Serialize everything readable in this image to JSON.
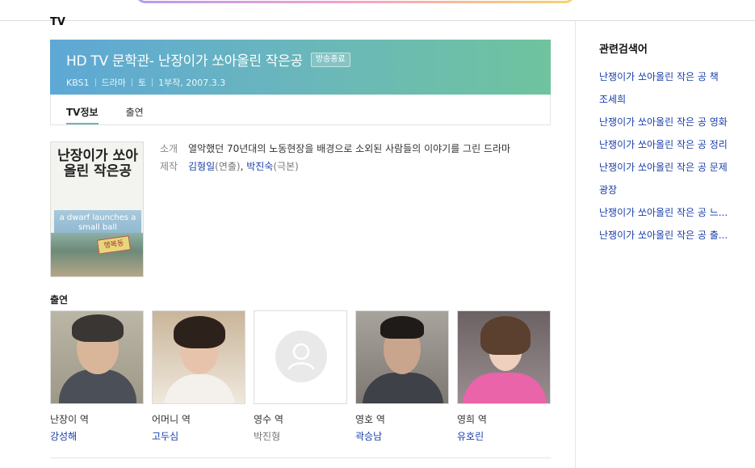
{
  "header": {
    "section_label": "TV"
  },
  "banner": {
    "title": "HD TV 문학관- 난장이가 쏘아올린 작은공",
    "badge": "방송종료",
    "meta": [
      "KBS1",
      "드라마",
      "토",
      "1부작, 2007.3.3"
    ]
  },
  "tabs": [
    {
      "label": "TV정보",
      "active": true
    },
    {
      "label": "출연",
      "active": false
    }
  ],
  "poster": {
    "title": "난장이가 쏘아올린 작은공",
    "subtitle": "a dwarf launches a small ball",
    "sign": "행복동"
  },
  "detail": {
    "intro_key": "소개",
    "intro_val": "열악했던 70년대의 노동현장을 배경으로 소외된 사람들의 이야기를 그린 드라마",
    "prod_key": "제작",
    "director": "김형일",
    "director_role": "(연출)",
    "comma": ", ",
    "writer": "박진숙",
    "writer_role": "(극본)"
  },
  "cast_title": "출연",
  "cast": [
    {
      "role": "난장이 역",
      "name": "강성해",
      "linked": true
    },
    {
      "role": "어머니 역",
      "name": "고두심",
      "linked": true
    },
    {
      "role": "영수 역",
      "name": "박진형",
      "linked": false
    },
    {
      "role": "영호 역",
      "name": "곽승남",
      "linked": true
    },
    {
      "role": "영희 역",
      "name": "유호린",
      "linked": true
    }
  ],
  "sidebar": {
    "title": "관련검색어",
    "items": [
      "난쟁이가 쏘아올린 작은 공 책",
      "조세희",
      "난쟁이가 쏘아올린 작은 공 영화",
      "난쟁이가 쏘아올린 작은 공 정리",
      "난쟁이가 쏘아올린 작은 공 문제",
      "광장",
      "난쟁이가 쏘아올린 작은 공 느...",
      "난쟁이가 쏘아올린 작은 공 출..."
    ]
  },
  "colors": {
    "link": "#1a3fa8",
    "banner_start": "#5ea8d6",
    "banner_end": "#6fc39e"
  }
}
